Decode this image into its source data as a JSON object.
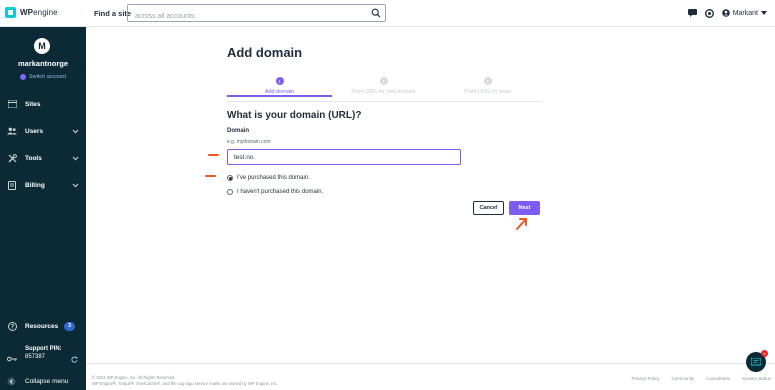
{
  "brand": {
    "logo_bold": "WP",
    "logo_rest": "engine"
  },
  "header": {
    "find_label": "Find a site",
    "search_placeholder": "across all accounts",
    "user_name": "Markant"
  },
  "sidebar": {
    "avatar_letter": "M",
    "account_name": "markantnorge",
    "switch_account": "Switch account",
    "items": [
      {
        "label": "Sites",
        "icon": "sites-icon",
        "has_chevron": false
      },
      {
        "label": "Users",
        "icon": "users-icon",
        "has_chevron": true
      },
      {
        "label": "Tools",
        "icon": "tools-icon",
        "has_chevron": true
      },
      {
        "label": "Billing",
        "icon": "billing-icon",
        "has_chevron": true
      }
    ],
    "resources_label": "Resources",
    "resources_count": "3",
    "support_label": "Support PIN:",
    "support_pin": "857387",
    "collapse_label": "Collapse menu"
  },
  "main": {
    "title": "Add domain",
    "steps": [
      {
        "number": "1",
        "label": "Add domain",
        "active": true
      },
      {
        "number": "2",
        "label": "Point DNS for root domain",
        "active": false
      },
      {
        "number": "3",
        "label": "Point DNS for www",
        "active": false
      }
    ],
    "question": "What is your domain (URL)?",
    "field_label": "Domain",
    "field_hint": "e.g. mydomain.com",
    "domain_value": "test.no",
    "radio_purchased": "I've purchased this domain.",
    "radio_not_purchased": "I haven't purchased this domain.",
    "selected_radio": "purchased",
    "cancel_label": "Cancel",
    "next_label": "Next"
  },
  "footer": {
    "copyright_line1": "© 2021 WP Engine, Inc. All Rights Reserved.",
    "copyright_line2": "WP Engine®, Torque®, EverCache®, and the cog logo service marks are owned by WP Engine, Inc.",
    "links": [
      "Privacy Policy",
      "Community",
      "Consultants",
      "System Status"
    ]
  },
  "chat": {
    "badge_count": "4"
  },
  "colors": {
    "accent": "#7e5bef",
    "sidebar_bg": "#0c2a36",
    "annotation": "#f0561f"
  }
}
